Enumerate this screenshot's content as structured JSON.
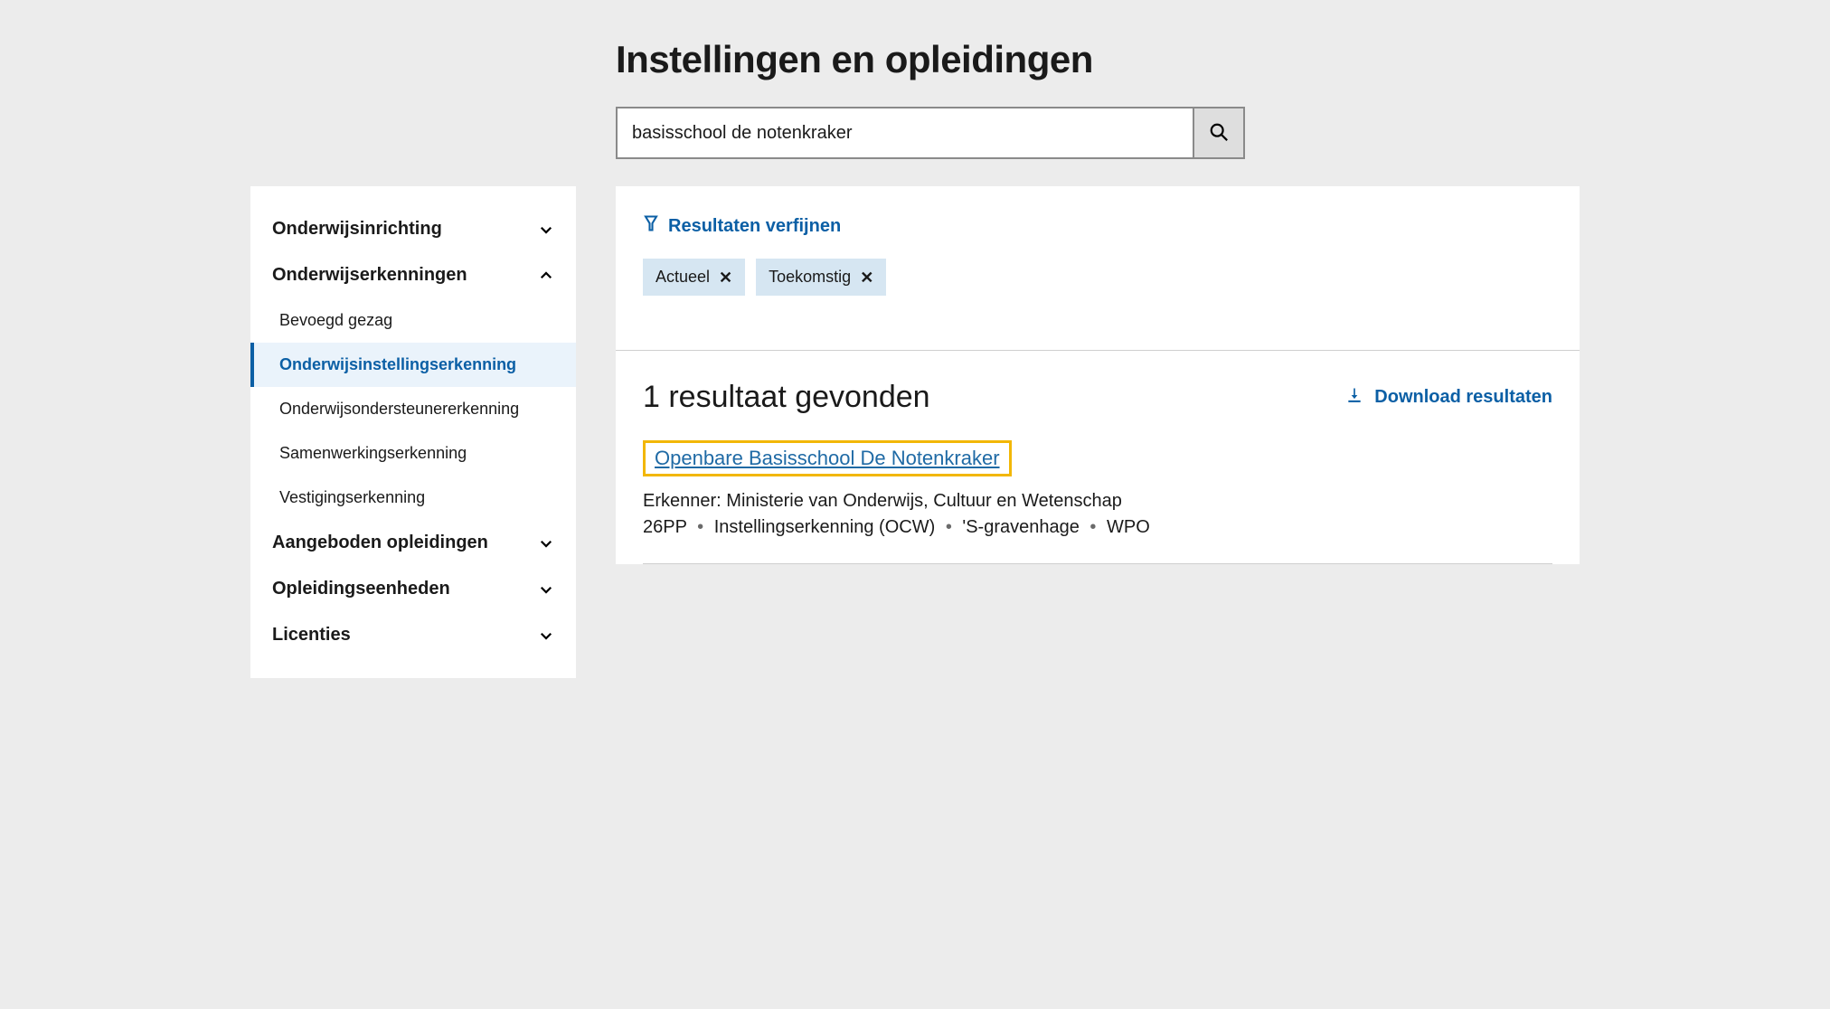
{
  "page": {
    "title": "Instellingen en opleidingen"
  },
  "search": {
    "value": "basisschool de notenkraker",
    "placeholder": ""
  },
  "sidebar": {
    "groups": [
      {
        "label": "Onderwijsinrichting",
        "expanded": false,
        "items": []
      },
      {
        "label": "Onderwijserkenningen",
        "expanded": true,
        "items": [
          {
            "label": "Bevoegd gezag",
            "active": false
          },
          {
            "label": "Onderwijsinstellingserkenning",
            "active": true
          },
          {
            "label": "Onderwijsondersteunererkenning",
            "active": false
          },
          {
            "label": "Samenwerkingserkenning",
            "active": false
          },
          {
            "label": "Vestigingserkenning",
            "active": false
          }
        ]
      },
      {
        "label": "Aangeboden opleidingen",
        "expanded": false,
        "items": []
      },
      {
        "label": "Opleidingseenheden",
        "expanded": false,
        "items": []
      },
      {
        "label": "Licenties",
        "expanded": false,
        "items": []
      }
    ]
  },
  "refine": {
    "title": "Resultaten verfijnen",
    "chips": [
      {
        "label": "Actueel"
      },
      {
        "label": "Toekomstig"
      }
    ]
  },
  "results": {
    "heading": "1 resultaat gevonden",
    "download_label": "Download resultaten",
    "items": [
      {
        "title": "Openbare Basisschool De Notenkraker",
        "erkenner_label": "Erkenner:",
        "erkenner_value": "Ministerie van Onderwijs, Cultuur en Wetenschap",
        "tags": [
          "26PP",
          "Instellingserkenning (OCW)",
          "'S-gravenhage",
          "WPO"
        ]
      }
    ]
  }
}
